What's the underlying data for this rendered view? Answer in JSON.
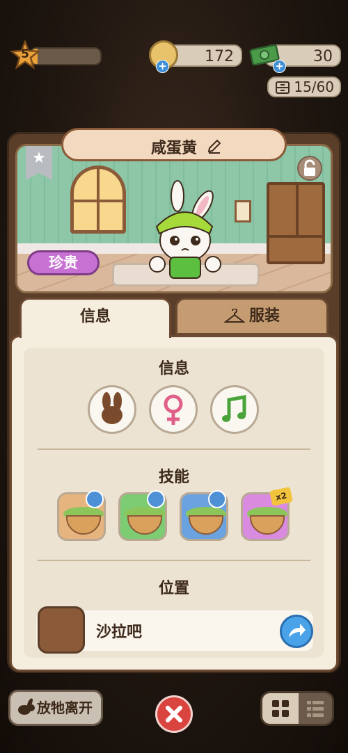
{
  "top_bar": {
    "level": "5",
    "level_progress": 0.1,
    "coins": "172",
    "cash": "30",
    "storage": "15/60"
  },
  "character": {
    "name": "咸蛋黄",
    "rarity": "珍贵"
  },
  "tabs": {
    "info": "信息",
    "outfit": "服装"
  },
  "sections": {
    "info_title": "信息",
    "skills_title": "技能",
    "location_title": "位置"
  },
  "traits": [
    "rabbit-icon",
    "female-icon",
    "music-note-icon"
  ],
  "skills": [
    {
      "color": "#e6b47e",
      "badge": "clock"
    },
    {
      "color": "#7dcb73",
      "badge": "clock"
    },
    {
      "color": "#6aa3df",
      "badge": "clock"
    },
    {
      "color": "#d98be0",
      "badge": "x2"
    }
  ],
  "skill_badge_x2": "x2",
  "location": {
    "name": "沙拉吧"
  },
  "bottom": {
    "release_label": "放牠离开"
  },
  "colors": {
    "rarity": "#c772d2",
    "accent_blue": "#4aa3e8",
    "close_red": "#d9453e"
  }
}
